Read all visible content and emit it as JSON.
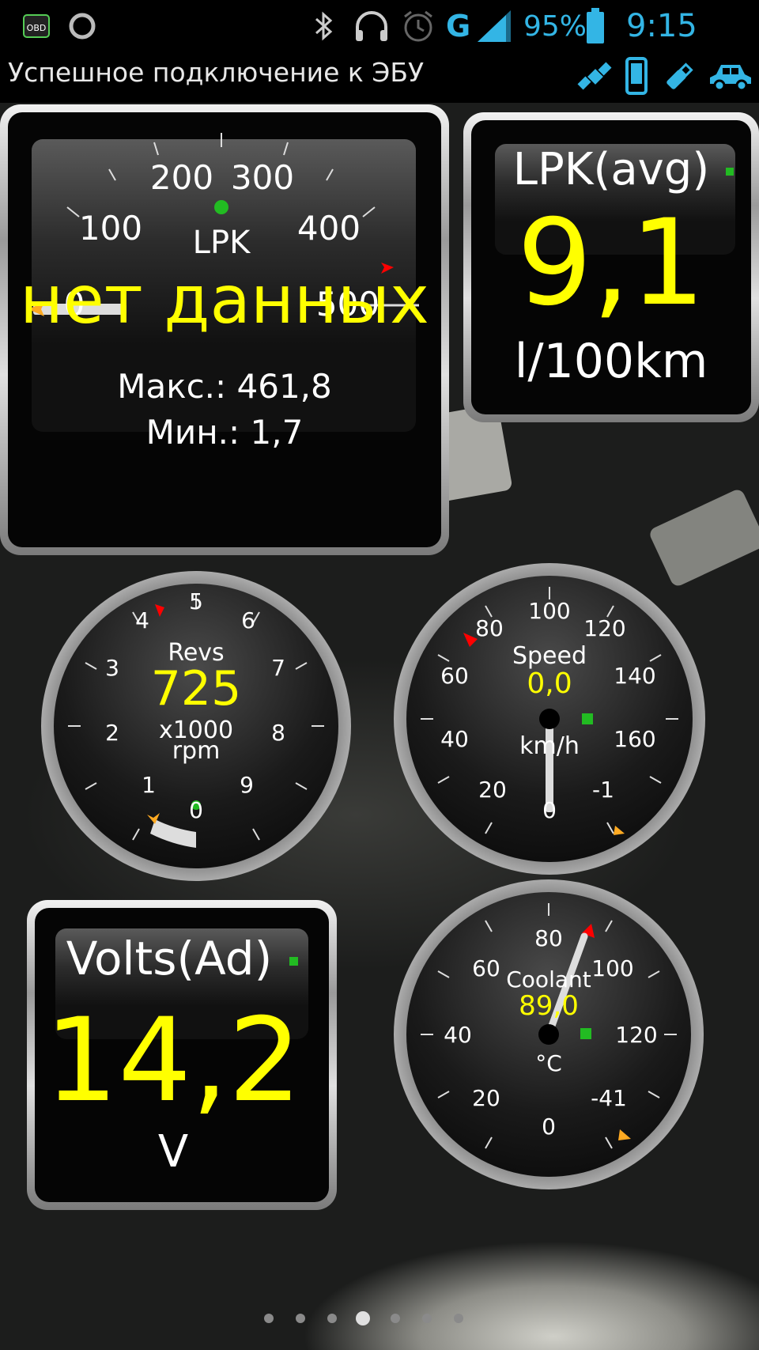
{
  "statusbar": {
    "network_letter": "G",
    "battery_percent": "95%",
    "time": "9:15",
    "accent_color": "#33b5e5",
    "icons": [
      "obd-icon",
      "gps-swirl-icon",
      "bluetooth-icon",
      "headphones-icon",
      "alarm-icon",
      "signal-icon",
      "battery-icon"
    ]
  },
  "titlebar": {
    "status_text": "Успешное подключение к ЭБУ",
    "icons": [
      "satellite-icon",
      "phone-icon",
      "usb-icon",
      "car-icon"
    ]
  },
  "lpk_gauge": {
    "label": "LPK",
    "no_data_text": "нет данных",
    "ticks": [
      "0",
      "100",
      "200",
      "300",
      "400",
      "500"
    ],
    "max_text": "Макс.: 461,8",
    "min_text": "Мин.: 1,7"
  },
  "lpk_avg": {
    "label": "LPK(avg)",
    "value": "9,1",
    "unit": "l/100km"
  },
  "revs": {
    "label": "Revs",
    "value": "725",
    "multiplier": "x1000",
    "unit": "rpm",
    "ticks": [
      "0",
      "1",
      "2",
      "3",
      "4",
      "5",
      "6",
      "7",
      "8",
      "9"
    ]
  },
  "speed": {
    "label": "Speed",
    "value": "0,0",
    "unit": "km/h",
    "ticks": [
      "0",
      "20",
      "40",
      "60",
      "80",
      "100",
      "120",
      "140",
      "160"
    ],
    "min_marker": "-1"
  },
  "volts": {
    "label": "Volts(Ad)",
    "value": "14,2",
    "unit": "V"
  },
  "coolant": {
    "label": "Coolant",
    "value": "89,0",
    "unit": "°C",
    "ticks": [
      "0",
      "20",
      "40",
      "60",
      "80",
      "100",
      "120"
    ],
    "min_marker": "-41"
  },
  "pager": {
    "count": 7,
    "active_index": 3
  },
  "colors": {
    "value_yellow": "#ffff00",
    "status_green": "#22bb22",
    "warn_red": "#ff0000",
    "min_orange": "#ffaa22"
  }
}
